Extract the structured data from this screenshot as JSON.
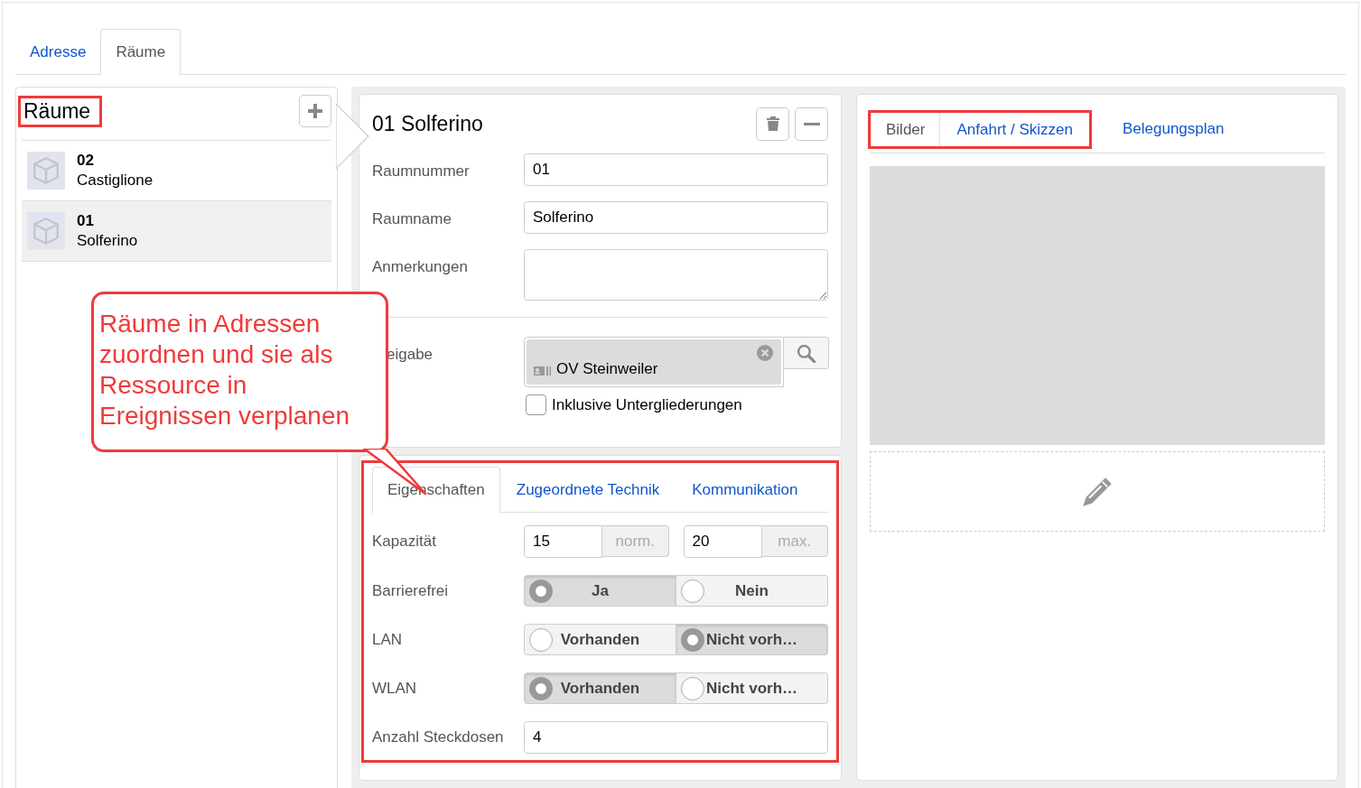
{
  "top_tabs": [
    {
      "label": "Adresse",
      "selected": false
    },
    {
      "label": "Räume",
      "selected": true
    }
  ],
  "rooms_panel": {
    "title": "Räume",
    "highlighted": true,
    "items": [
      {
        "number": "02",
        "name": "Castiglione",
        "selected": false
      },
      {
        "number": "01",
        "name": "Solferino",
        "selected": true
      }
    ]
  },
  "detail": {
    "title": "01 Solferino",
    "fields": [
      {
        "label": "Raumnummer",
        "kind": "input",
        "value": "01"
      },
      {
        "label": "Raumname",
        "kind": "input",
        "value": "Solferino"
      },
      {
        "label": "Anmerkungen",
        "kind": "textarea"
      }
    ],
    "release": {
      "label": "eigabe",
      "tag": "OV Steinweiler",
      "checkbox": {
        "label": "Inklusive Untergliederungen",
        "checked": false
      }
    }
  },
  "properties": {
    "highlighted": true,
    "tabs": [
      {
        "label": "Eigenschaften",
        "selected": true
      },
      {
        "label": "Zugeordnete Technik",
        "selected": false
      },
      {
        "label": "Kommunikation",
        "selected": false
      }
    ],
    "rows": [
      {
        "label": "Kapazität",
        "kind": "capacity",
        "inputs": [
          {
            "value": "15",
            "unit": "norm."
          },
          {
            "value": "20",
            "unit": "max."
          }
        ]
      },
      {
        "label": "Barrierefrei",
        "kind": "radio",
        "options": [
          {
            "label": "Ja",
            "selected": true
          },
          {
            "label": "Nein",
            "selected": false
          }
        ]
      },
      {
        "label": "LAN",
        "kind": "radio",
        "options": [
          {
            "label": "Vorhanden",
            "selected": false
          },
          {
            "label": "Nicht vorh…",
            "selected": true
          }
        ]
      },
      {
        "label": "WLAN",
        "kind": "radio",
        "options": [
          {
            "label": "Vorhanden",
            "selected": true
          },
          {
            "label": "Nicht vorh…",
            "selected": false
          }
        ]
      },
      {
        "label": "Anzahl Steckdosen",
        "kind": "input",
        "value": "4"
      }
    ]
  },
  "media": {
    "tabs": [
      {
        "label": "Bilder",
        "selected": true,
        "highlighted": true
      },
      {
        "label": "Anfahrt / Skizzen",
        "selected": false,
        "highlighted": true
      },
      {
        "label": "Belegungsplan",
        "selected": false,
        "highlighted": false
      }
    ]
  },
  "callout": {
    "text": "Räume in Adressen zuordnen und sie als Ressource in Ereignissen verplanen"
  }
}
